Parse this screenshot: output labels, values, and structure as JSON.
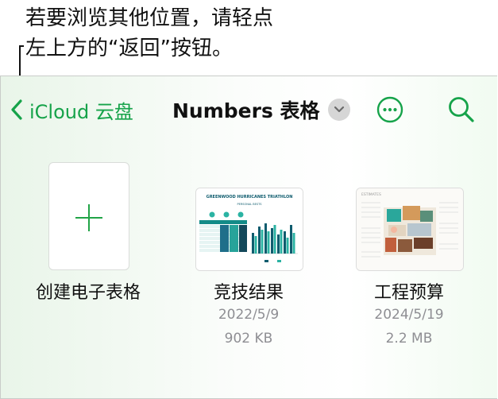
{
  "callout": {
    "line1": "若要浏览其他位置，请轻点",
    "line2": "左上方的“返回”按钮。"
  },
  "toolbar": {
    "back_label": "iCloud 云盘",
    "title": "Numbers 表格",
    "accent_color": "#16a34a"
  },
  "items": [
    {
      "name": "创建电子表格"
    },
    {
      "name": "竞技结果",
      "date": "2022/5/9",
      "size": "902 KB",
      "thumb_title": "GREENWOOD HURRICANES TRIATHLON",
      "thumb_subtitle": "PERSONAL BESTS"
    },
    {
      "name": "工程预算",
      "date": "2024/5/19",
      "size": "2.2 MB",
      "thumb_title": "ESTIMATES"
    }
  ]
}
